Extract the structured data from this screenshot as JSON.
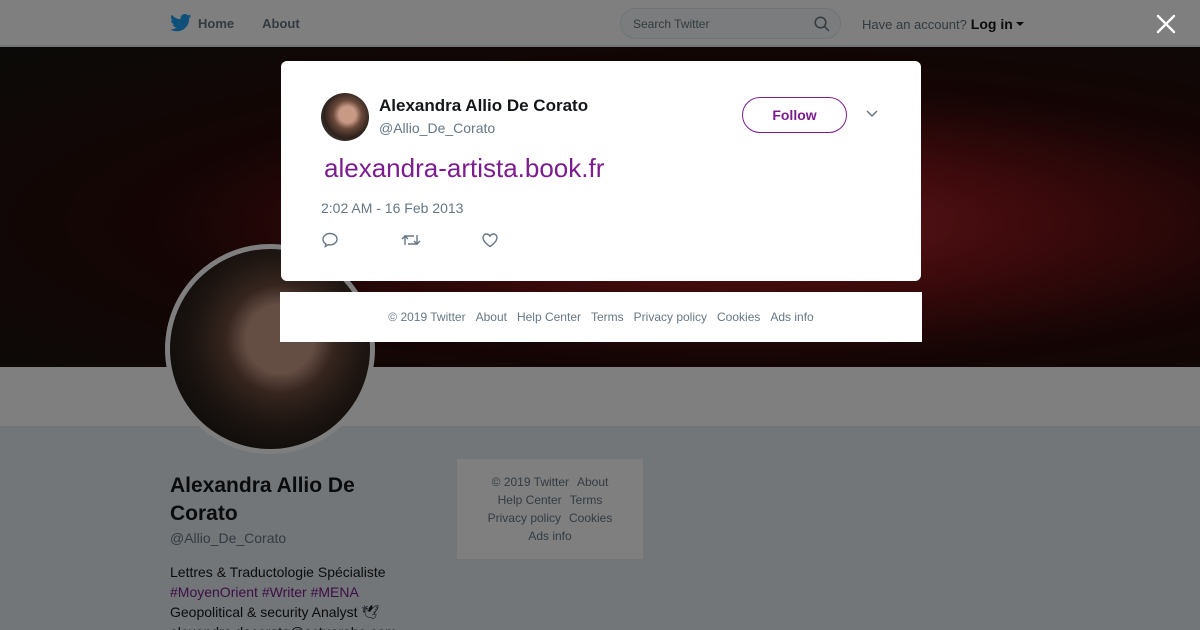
{
  "nav": {
    "home": "Home",
    "about": "About",
    "search_placeholder": "Search Twitter",
    "have_account": "Have an account?",
    "login": "Log in"
  },
  "profile": {
    "name": "Alexandra Allio De Corato",
    "handle": "@Allio_De_Corato",
    "bio_line1": "Lettres & Traductologie Spécialiste",
    "hashtags": [
      "#MoyenOrient",
      "#Writer",
      "#MENA"
    ],
    "bio_line3": "Geopolitical & security Analyst 🕊",
    "email": "alexandra.decorato@actuarabe.com"
  },
  "side_footer": [
    "© 2019 Twitter",
    "About",
    "Help Center",
    "Terms",
    "Privacy policy",
    "Cookies",
    "Ads info"
  ],
  "tweet": {
    "name": "Alexandra Allio De Corato",
    "handle": "@Allio_De_Corato",
    "follow_label": "Follow",
    "link": "alexandra-artista.book.fr",
    "timestamp": "2:02 AM - 16 Feb 2013"
  },
  "footer": [
    "© 2019 Twitter",
    "About",
    "Help Center",
    "Terms",
    "Privacy policy",
    "Cookies",
    "Ads info"
  ],
  "colors": {
    "accent": "#7c1d8f",
    "twitter_blue": "#1da1f2"
  }
}
